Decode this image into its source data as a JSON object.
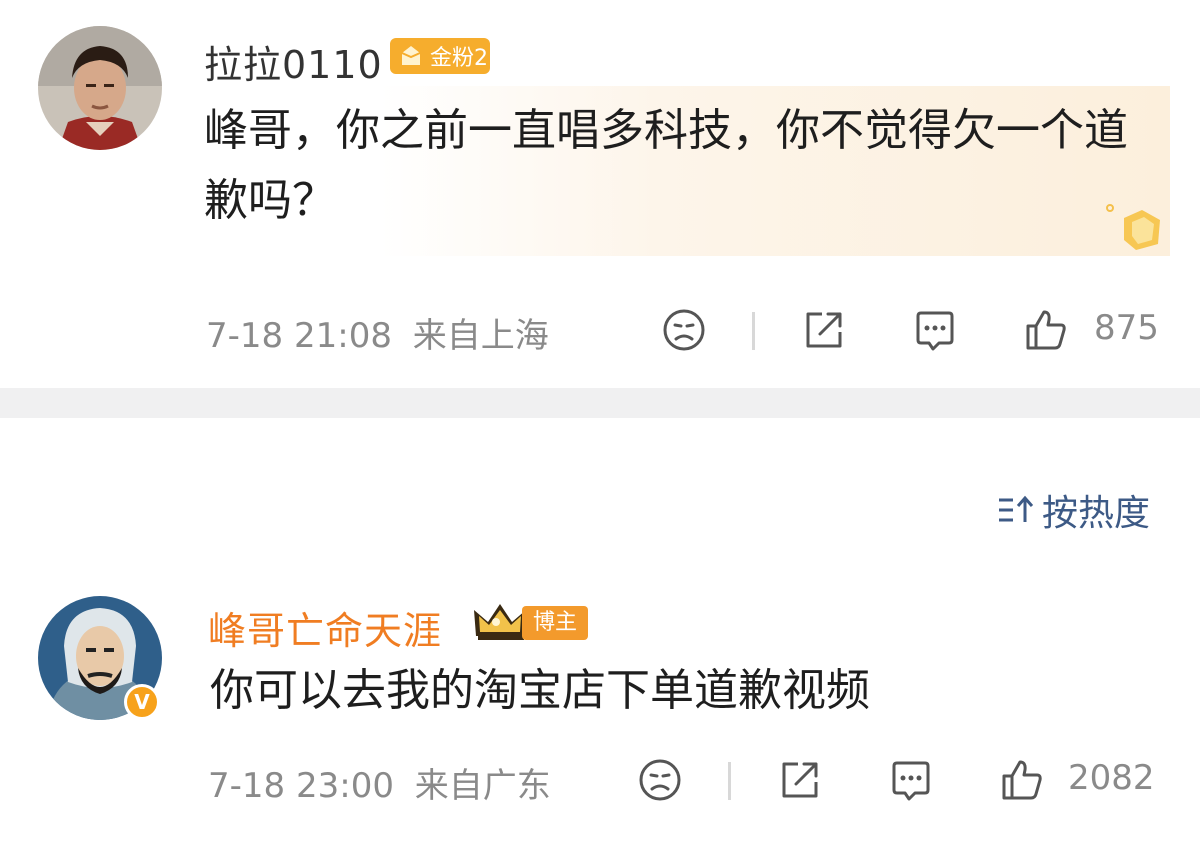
{
  "comments": [
    {
      "username": "拉拉0110",
      "badge": "金粉2",
      "text": "峰哥，你之前一直唱多科技，你不觉得欠一个道歉吗？",
      "time": "7-18 21:08",
      "location": "来自上海",
      "likes": "875",
      "avatar_icon": "portrait-avatar-icon"
    },
    {
      "username": "峰哥亡命天涯",
      "badge": "博主",
      "verified_mark": "V",
      "text": "你可以去我的淘宝店下单道歉视频",
      "time": "7-18 23:00",
      "location": "来自广东",
      "likes": "2082",
      "avatar_icon": "cartoon-avatar-icon"
    }
  ],
  "sort": {
    "label": "按热度",
    "icon": "sort-icon"
  },
  "colors": {
    "username_author": "#f07d22",
    "badge_gold": "#f6ad2d",
    "link_blue": "#3d5a86",
    "meta_gray": "#8a8a8a"
  }
}
